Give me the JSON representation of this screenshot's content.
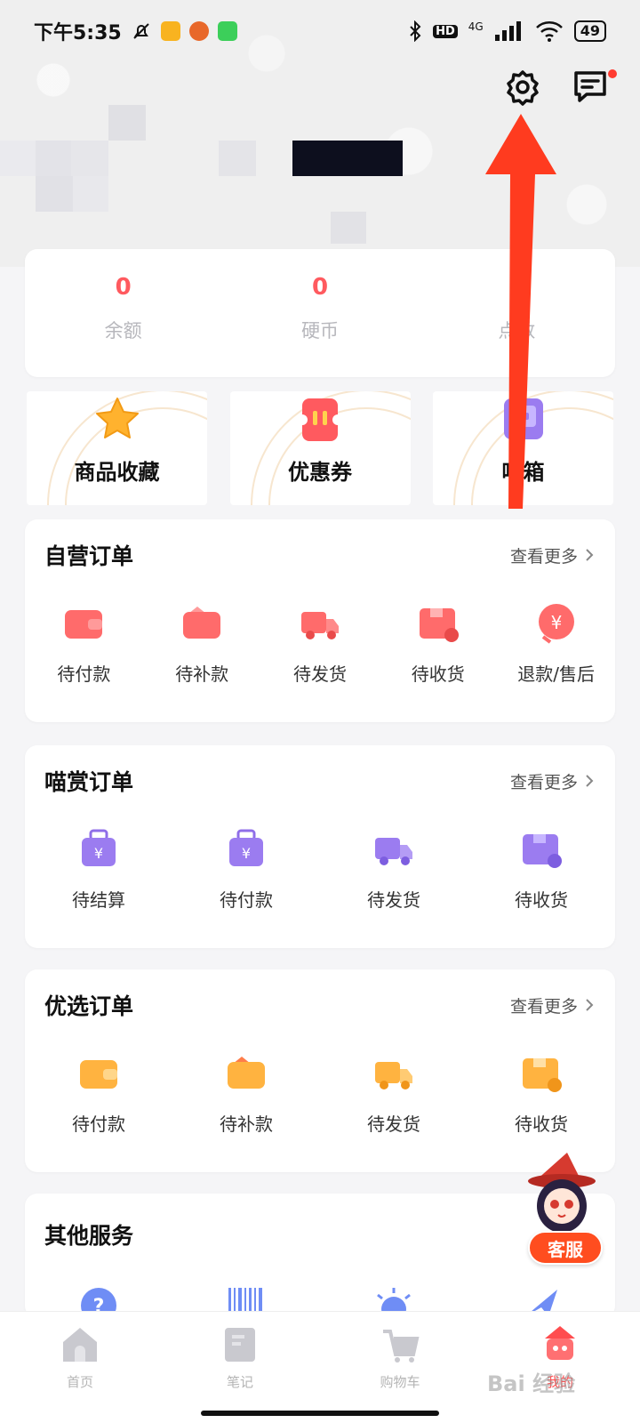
{
  "status_bar": {
    "time": "下午5:35",
    "network": "4G",
    "hd": "HD",
    "battery": "49"
  },
  "stats": [
    {
      "value": "0",
      "label": "余额"
    },
    {
      "value": "0",
      "label": "硬币"
    },
    {
      "value": "0",
      "label": "点数"
    }
  ],
  "quick_links": [
    {
      "label": "商品收藏",
      "icon": "star-icon"
    },
    {
      "label": "优惠券",
      "icon": "coupon-icon"
    },
    {
      "label": "喵箱",
      "icon": "box-icon"
    }
  ],
  "self_orders": {
    "title": "自营订单",
    "more": "查看更多",
    "items": [
      {
        "label": "待付款",
        "icon": "wallet-icon"
      },
      {
        "label": "待补款",
        "icon": "wallet-refill-icon"
      },
      {
        "label": "待发货",
        "icon": "truck-icon"
      },
      {
        "label": "待收货",
        "icon": "package-icon"
      },
      {
        "label": "退款/售后",
        "icon": "refund-icon"
      }
    ]
  },
  "meow_orders": {
    "title": "喵赏订单",
    "more": "查看更多",
    "items": [
      {
        "label": "待结算",
        "icon": "bag-icon"
      },
      {
        "label": "待付款",
        "icon": "bag-icon"
      },
      {
        "label": "待发货",
        "icon": "truck-icon"
      },
      {
        "label": "待收货",
        "icon": "package-icon"
      }
    ]
  },
  "pick_orders": {
    "title": "优选订单",
    "more": "查看更多",
    "items": [
      {
        "label": "待付款",
        "icon": "wallet-icon"
      },
      {
        "label": "待补款",
        "icon": "wallet-refill-icon"
      },
      {
        "label": "待发货",
        "icon": "truck-icon"
      },
      {
        "label": "待收货",
        "icon": "package-icon"
      }
    ]
  },
  "other_services": {
    "title": "其他服务"
  },
  "customer_service": {
    "label": "客服"
  },
  "tabbar": [
    {
      "label": "首页",
      "icon": "home-icon"
    },
    {
      "label": "笔记",
      "icon": "note-icon"
    },
    {
      "label": "购物车",
      "icon": "cart-icon"
    },
    {
      "label": "我的",
      "icon": "profile-icon",
      "active": true
    }
  ],
  "watermark": "Bai 经验",
  "colors": {
    "accent": "#ff5a5f",
    "self_order_icon": "#ff6b6b",
    "meow_order_icon": "#9b7cf0",
    "pick_order_icon": "#ffb340",
    "annotation_arrow": "#ff3b1f"
  }
}
